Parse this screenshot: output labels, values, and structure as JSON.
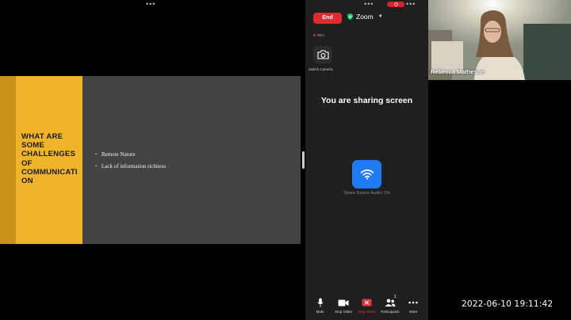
{
  "slide": {
    "title_lines": [
      "WHAT ARE",
      "SOME",
      "CHALLENGES",
      "OF",
      "COMMUNICATI",
      "ON"
    ],
    "bullets": [
      "Remote Nature",
      "Lack of information richness"
    ]
  },
  "zoom": {
    "end_label": "End",
    "app_title": "Zoom",
    "rec_label": "REC",
    "switch_camera_label": "Switch Camera",
    "sharing_status": "You are sharing screen",
    "audio_status": "Share Device Audio: On",
    "toolbar": {
      "mute": "Mute",
      "stop_video": "Stop Video",
      "stop_share": "Stop Share",
      "participants": "Participants",
      "participants_count": "1",
      "more": "More"
    },
    "accent_color": "#1f7bf3",
    "end_color": "#e02a2e"
  },
  "video": {
    "participant_name": "Rebecca Matheson"
  },
  "timestamp": "2022-06-10  19:11:42"
}
